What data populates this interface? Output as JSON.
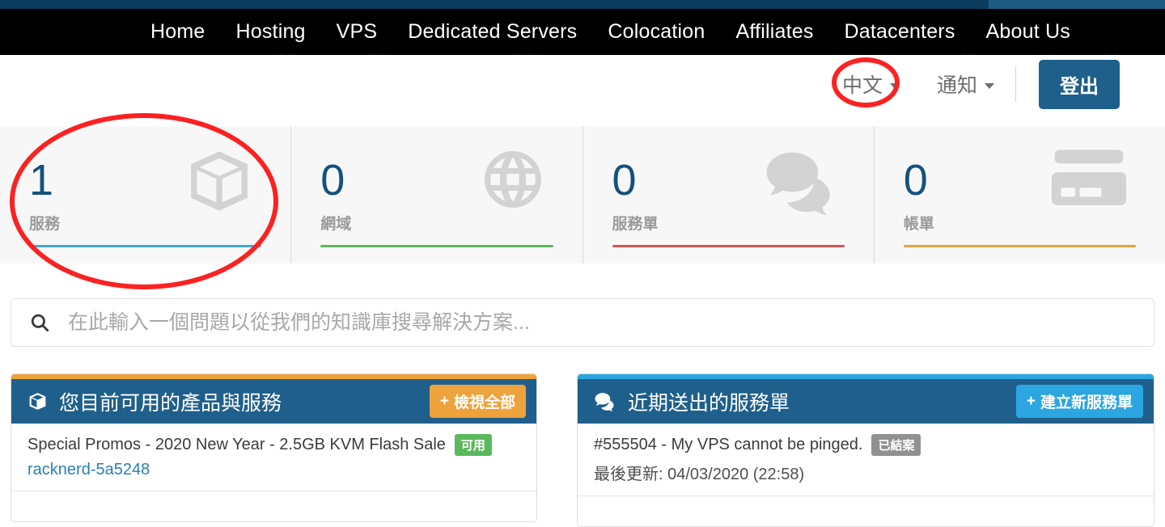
{
  "topbar": {
    "left_color": "#0a3d5e",
    "right_color": "#1d5c85"
  },
  "nav": {
    "items": [
      {
        "label": "Home",
        "has_dropdown": false
      },
      {
        "label": "Hosting",
        "has_dropdown": true
      },
      {
        "label": "VPS",
        "has_dropdown": true
      },
      {
        "label": "Dedicated Servers",
        "has_dropdown": true
      },
      {
        "label": "Colocation",
        "has_dropdown": false
      },
      {
        "label": "Affiliates",
        "has_dropdown": false
      },
      {
        "label": "Datacenters",
        "has_dropdown": false
      },
      {
        "label": "About Us",
        "has_dropdown": false
      }
    ]
  },
  "utility": {
    "language_label": "中文",
    "notifications_label": "通知",
    "logout_label": "登出"
  },
  "stats": [
    {
      "value": "1",
      "label": "服務",
      "rule_color": "#3fa9dd",
      "icon": "box-icon"
    },
    {
      "value": "0",
      "label": "網域",
      "rule_color": "#5cb85c",
      "icon": "globe-icon"
    },
    {
      "value": "0",
      "label": "服務單",
      "rule_color": "#d9534f",
      "icon": "chat-icon"
    },
    {
      "value": "0",
      "label": "帳單",
      "rule_color": "#eda23c",
      "icon": "credit-card-icon"
    }
  ],
  "search": {
    "icon": "search-icon",
    "value": "",
    "placeholder": "在此輸入一個問題以從我們的知識庫搜尋解決方案..."
  },
  "panels": {
    "services": {
      "top_border_color": "#eda23c",
      "header_icon": "box-icon",
      "title": "您目前可用的產品與服務",
      "button_label": "檢視全部",
      "button_plus": "+",
      "rows": [
        {
          "name": "Special Promos - 2020 New Year - 2.5GB KVM Flash Sale",
          "status": "可用",
          "domain": "racknerd-5a5248"
        }
      ]
    },
    "tickets": {
      "top_border_color": "#2ba6e0",
      "header_icon": "chat-icon",
      "title": "近期送出的服務單",
      "button_label": "建立新服務單",
      "button_plus": "+",
      "rows": [
        {
          "subject": "#555504 - My VPS cannot be pinged.",
          "status": "已結案",
          "updated": "最後更新: 04/03/2020 (22:58)"
        }
      ]
    }
  },
  "annotations": {
    "services_stat_highlight": "red-circle",
    "language_highlight": "red-circle"
  }
}
